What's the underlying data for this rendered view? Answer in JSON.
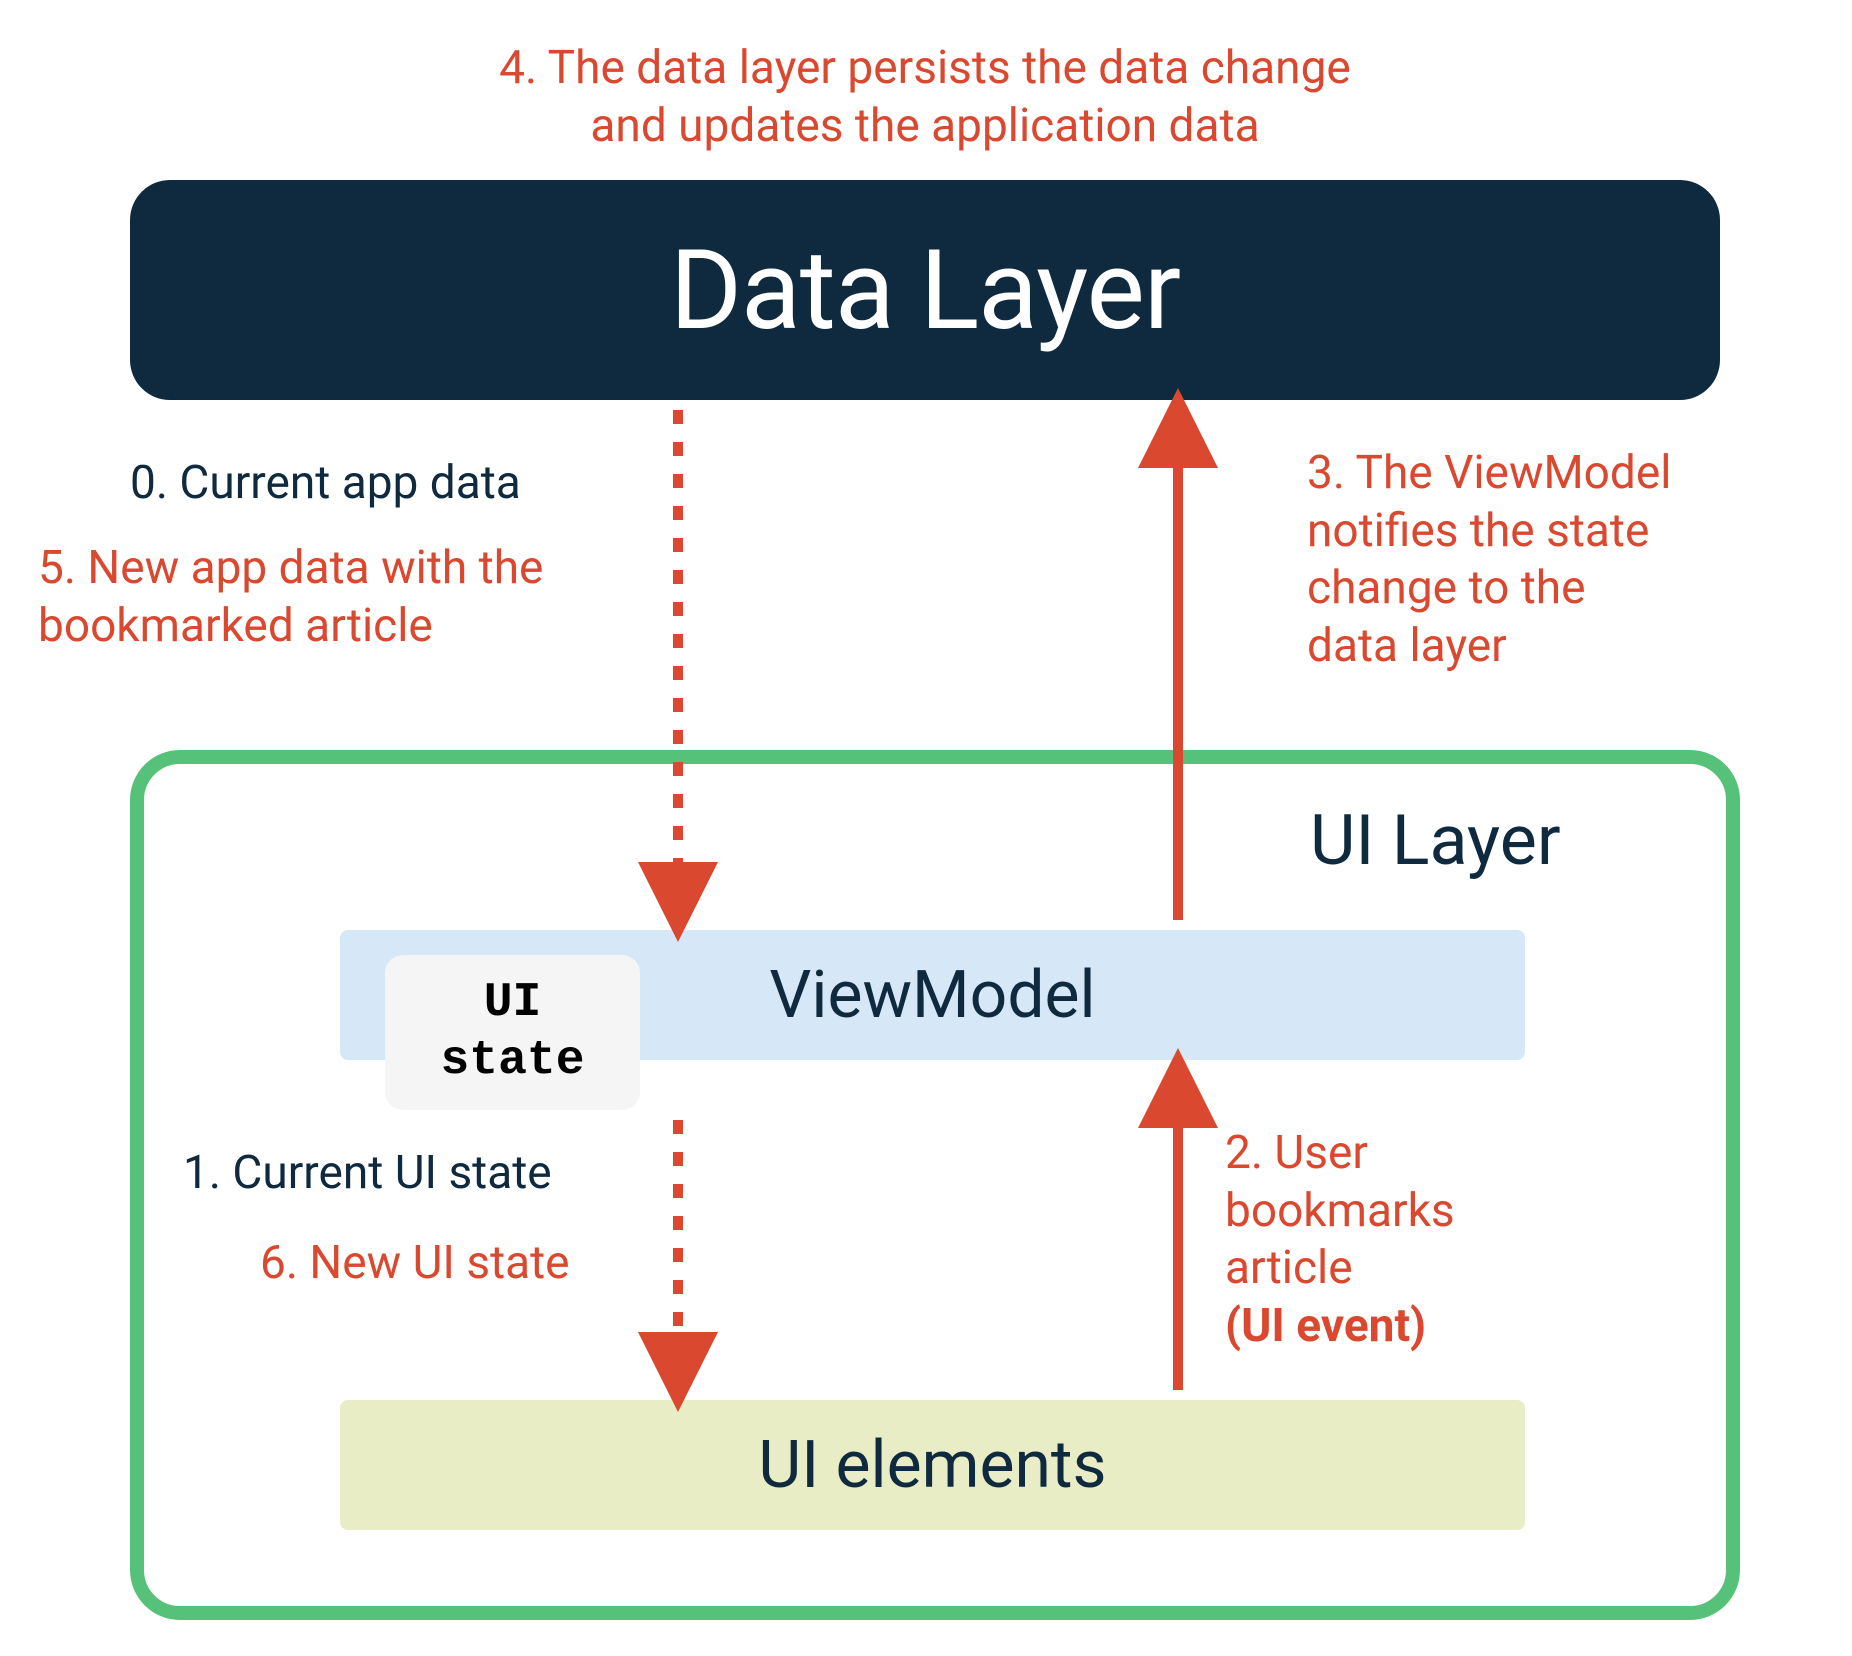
{
  "boxes": {
    "data_layer": "Data Layer",
    "ui_layer": "UI Layer",
    "viewmodel": "ViewModel",
    "ui_state": "UI\nstate",
    "ui_elements": "UI elements"
  },
  "annotations": {
    "step0": "0. Current app data",
    "step1": "1. Current UI state",
    "step2_a": "2. User",
    "step2_b": "bookmarks",
    "step2_c": "article",
    "step2_d": "(UI event)",
    "step3_a": "3. The ViewModel",
    "step3_b": "notifies the state",
    "step3_c": "change to the",
    "step3_d": "data layer",
    "step4_a": "4. The data layer persists the data change",
    "step4_b": "and updates the application data",
    "step5_a": "5. New app data with the",
    "step5_b": "bookmarked article",
    "step6": "6. New UI state"
  },
  "colors": {
    "dark": "#0f2a3f",
    "accent": "#d9482f",
    "green": "#56c179",
    "lightblue": "#d6e8f8",
    "lightgreen": "#e9edc5"
  }
}
